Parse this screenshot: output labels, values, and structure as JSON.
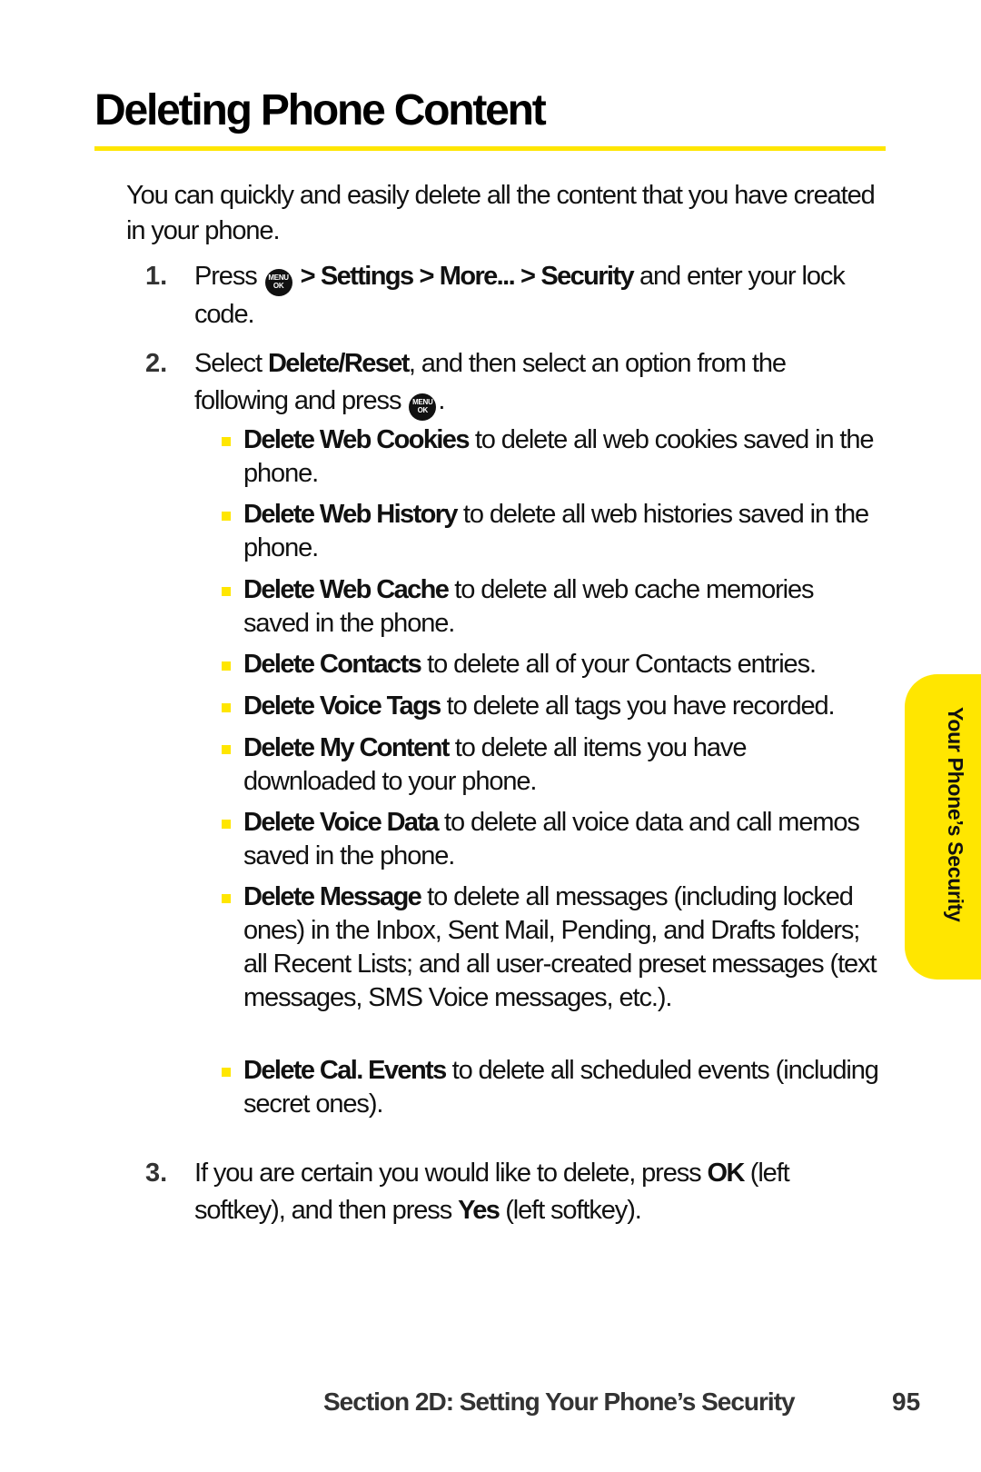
{
  "page": {
    "title": "Deleting Phone Content",
    "intro": "You can quickly and easily delete all the content that you have created in your phone.",
    "accent_color": "#FFE600"
  },
  "steps": [
    {
      "number": "1.",
      "parts": {
        "press": "Press",
        "path_sep": ">",
        "path_1": "Settings",
        "path_2": "More...",
        "path_3": "Security",
        "tail": " and enter your lock code."
      }
    },
    {
      "number": "2.",
      "parts": {
        "select": "Select ",
        "bold": "Delete/Reset",
        "tail": ", and then select an option from the following and press",
        "end": "."
      }
    },
    {
      "number": "3.",
      "parts": {
        "lead": "If you are certain you would like to delete, press ",
        "ok": "OK",
        "mid": " (left softkey), and then press ",
        "yes": "Yes",
        "tail": " (left softkey)."
      }
    }
  ],
  "menu_key_icon": {
    "top": "MENU",
    "bottom": "OK",
    "semantic": "menu-ok-key-icon"
  },
  "options": [
    {
      "name": "Delete Web Cookies",
      "desc": " to delete all web cookies saved in the phone."
    },
    {
      "name": "Delete Web History",
      "desc": " to delete all web histories saved in the phone."
    },
    {
      "name": "Delete Web Cache",
      "desc": " to delete all web cache memories saved in the phone."
    },
    {
      "name": "Delete Contacts",
      "desc": " to delete all of your Contacts entries."
    },
    {
      "name": "Delete Voice Tags",
      "desc": " to delete all tags you have recorded."
    },
    {
      "name": "Delete My Content",
      "desc": " to delete all items you have downloaded to your phone."
    },
    {
      "name": "Delete Voice Data",
      "desc": " to delete all voice data and call memos saved in the phone."
    },
    {
      "name": "Delete Message",
      "desc": " to delete all messages (including locked ones) in the Inbox, Sent Mail, Pending, and Drafts folders; all Recent Lists; and all user-created preset messages (text messages, SMS Voice messages, etc.)."
    },
    {
      "name": "Delete Cal. Events",
      "desc": " to delete all scheduled events (including secret ones)."
    }
  ],
  "side_tab": {
    "label": "Your Phone’s Security"
  },
  "footer": {
    "section": "Section 2D: Setting Your Phone’s Security",
    "page_number": "95"
  }
}
